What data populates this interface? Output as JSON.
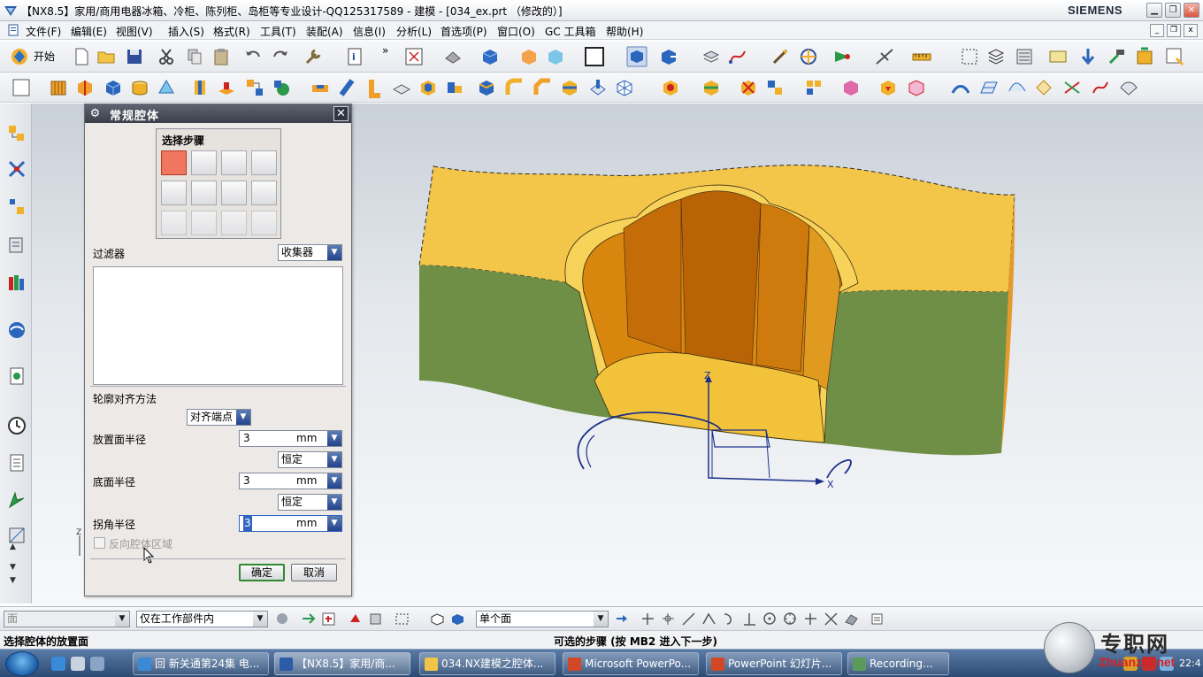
{
  "title_bar": {
    "title": "【NX8.5】家用/商用电器冰箱、冷柜、陈列柜、岛柜等专业设计-QQ125317589 - 建模 - [034_ex.prt （修改的）]",
    "brand": "SIEMENS",
    "minimize": "▁",
    "restore": "❐",
    "close": "✕"
  },
  "menu_bar": {
    "items": [
      "文件(F)",
      "编辑(E)",
      "视图(V)",
      "插入(S)",
      "格式(R)",
      "工具(T)",
      "装配(A)",
      "信息(I)",
      "分析(L)",
      "首选项(P)",
      "窗口(O)",
      "GC 工具箱",
      "帮助(H)"
    ],
    "mdi_minimize": "_",
    "mdi_restore": "❐",
    "mdi_close": "x"
  },
  "toolbar": {
    "start_label": "开始",
    "overflow": "»"
  },
  "dialog": {
    "title": "常规腔体",
    "close": "✕",
    "steps_label": "选择步骤",
    "filter_label": "过滤器",
    "filter_value": "收集器",
    "alignment_label": "轮廓对齐方法",
    "alignment_value": "对齐端点",
    "placement_radius_label": "放置面半径",
    "placement_radius_value": "3",
    "placement_radius_unit": "mm",
    "placement_radius_mode": "恒定",
    "floor_radius_label": "底面半径",
    "floor_radius_value": "3",
    "floor_radius_unit": "mm",
    "floor_radius_mode": "恒定",
    "corner_radius_label": "拐角半径",
    "corner_radius_value": "3",
    "corner_radius_unit": "mm",
    "reverse_label": "反向腔体区域",
    "ok": "确定",
    "cancel": "取消"
  },
  "viewport": {
    "axis_z": "Z",
    "axis_x": "X",
    "left_triad_z": "Z",
    "colors": {
      "body_top": "#f3c64a",
      "body_side": "#6f8f47",
      "pocket_inner": "#d9860f",
      "curve": "#1c2f8a"
    }
  },
  "selection_bar": {
    "type_filter": "面",
    "scope_filter": "仅在工作部件内",
    "face_rule": "单个面"
  },
  "status_bar": {
    "prompt": "选择腔体的放置面",
    "hint": "可选的步骤 (按 MB2 进入下一步)"
  },
  "taskbar": {
    "tasks": [
      "回 新关通第24集 电...",
      "【NX8.5】家用/商...",
      "034.NX建模之腔体...",
      "Microsoft PowerPo...",
      "PowerPoint 幻灯片...",
      "Recording..."
    ],
    "time": "22:4"
  },
  "watermark": {
    "cn": "专职网",
    "en": "Zhuanzhi.net"
  }
}
